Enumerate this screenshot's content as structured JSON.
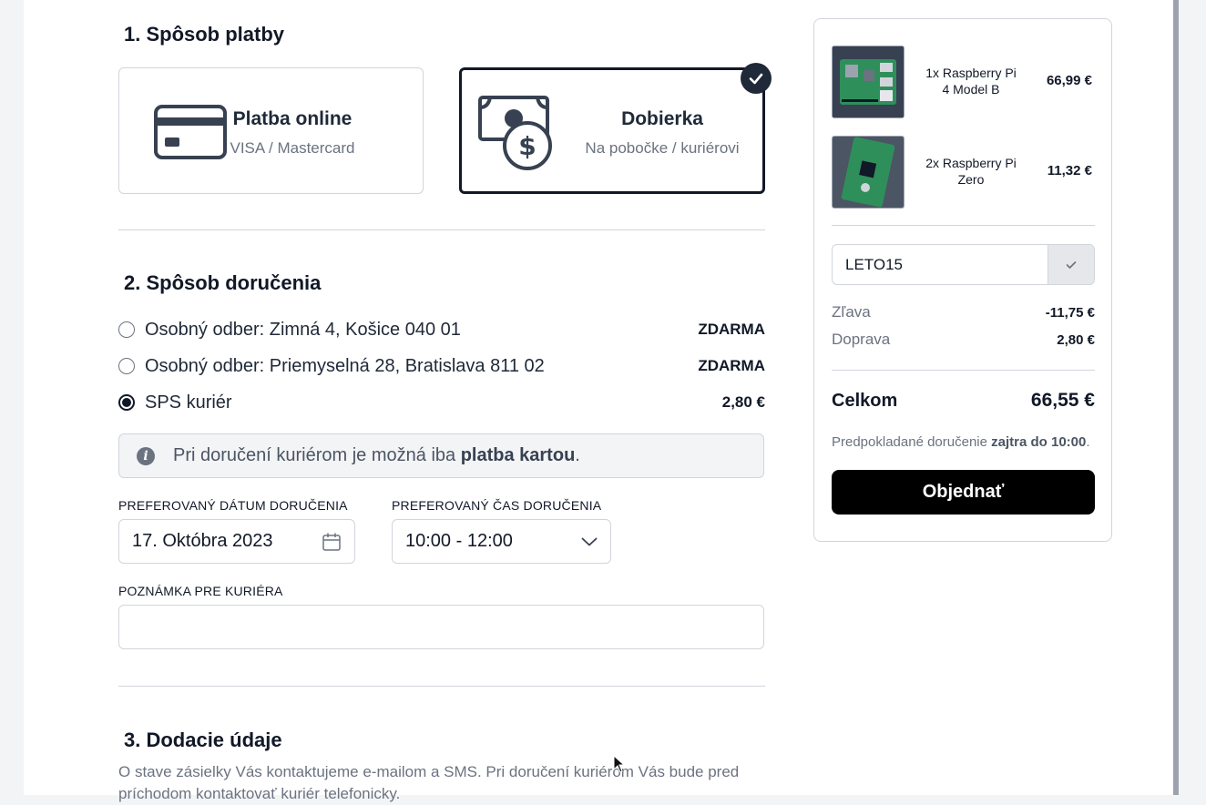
{
  "sections": {
    "payment_title": "1. Spôsob platby",
    "delivery_title": "2. Spôsob doručenia",
    "shipping_title": "3. Dodacie údaje"
  },
  "payment": {
    "options": [
      {
        "title": "Platba online",
        "subtitle": "VISA / Mastercard",
        "icon": "credit-card-icon",
        "selected": false
      },
      {
        "title": "Dobierka",
        "subtitle": "Na pobočke / kuriérovi",
        "icon": "cash-dollar-icon",
        "selected": true
      }
    ]
  },
  "delivery": {
    "options": [
      {
        "label": "Osobný odber: Zimná 4, Košice 040 01",
        "price": "ZDARMA",
        "selected": false
      },
      {
        "label": "Osobný odber: Priemyselná 28, Bratislava 811 02",
        "price": "ZDARMA",
        "selected": false
      },
      {
        "label": "SPS kuriér",
        "price": "2,80 €",
        "selected": true
      }
    ],
    "info_prefix": "Pri doručení kuriérom je možná iba ",
    "info_bold": "platba kartou",
    "info_suffix": ".",
    "date_label": "PREFEROVANÝ DÁTUM DORUČENIA",
    "date_value": "17. Októbra 2023",
    "time_label": "PREFEROVANÝ ČAS DORUČENIA",
    "time_value": "10:00 - 12:00",
    "note_label": "POZNÁMKA PRE KURIÉRA",
    "note_value": ""
  },
  "shipping": {
    "description": "O stave zásielky Vás kontaktujeme e-mailom a SMS. Pri doručení kuriérom Vás bude pred príchodom kontaktovať kuriér telefonicky."
  },
  "cart": {
    "items": [
      {
        "qty": "1x",
        "name": "Raspberry Pi 4 Model B",
        "price": "66,99 €"
      },
      {
        "qty": "2x",
        "name": "Raspberry Pi Zero",
        "price": "11,32 €"
      }
    ],
    "coupon_code": "LETO15",
    "discount_label": "Zľava",
    "discount_value": "-11,75 €",
    "shipping_label": "Doprava",
    "shipping_value": "2,80 €",
    "total_label": "Celkom",
    "total_value": "66,55 €",
    "eta_prefix": "Predpokladané doručenie ",
    "eta_bold": "zajtra do 10:00",
    "eta_suffix": ".",
    "order_button": "Objednať"
  },
  "colors": {
    "accent": "#111827",
    "button": "#000000",
    "info_bg": "#f3f4f6"
  }
}
